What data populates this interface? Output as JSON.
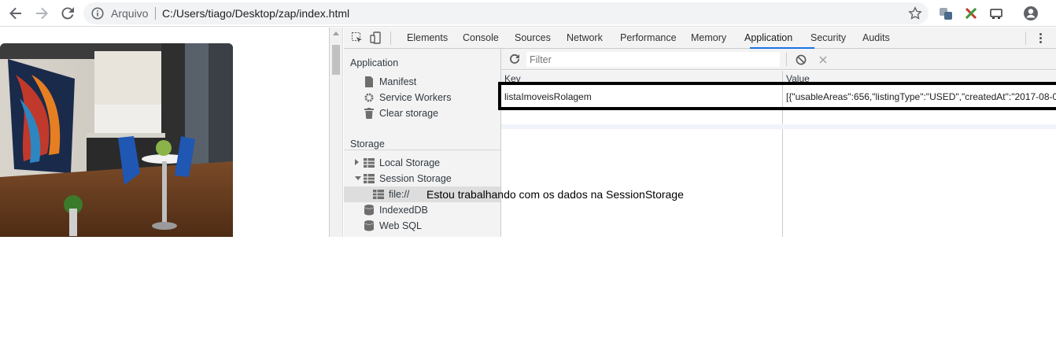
{
  "browser": {
    "address_label": "Arquivo",
    "url": "C:/Users/tiago/Desktop/zap/index.html"
  },
  "devtools": {
    "tabs": [
      "Elements",
      "Console",
      "Sources",
      "Network",
      "Performance",
      "Memory",
      "Application",
      "Security",
      "Audits"
    ],
    "active_tab": "Application",
    "sidebar": {
      "application_heading": "Application",
      "application_items": [
        "Manifest",
        "Service Workers",
        "Clear storage"
      ],
      "storage_heading": "Storage",
      "storage_items": [
        "Local Storage",
        "Session Storage",
        "file://",
        "IndexedDB",
        "Web SQL"
      ]
    },
    "filter_placeholder": "Filter",
    "columns": {
      "key": "Key",
      "value": "Value"
    },
    "rows": [
      {
        "key": "listaImoveisRolagem",
        "value": "[{\"usableAreas\":656,\"listingType\":\"USED\",\"createdAt\":\"2017-08-0..."
      }
    ],
    "accent_color": "#1a73e8"
  },
  "annotation": "Estou trabalhando com os dados na SessionStorage"
}
